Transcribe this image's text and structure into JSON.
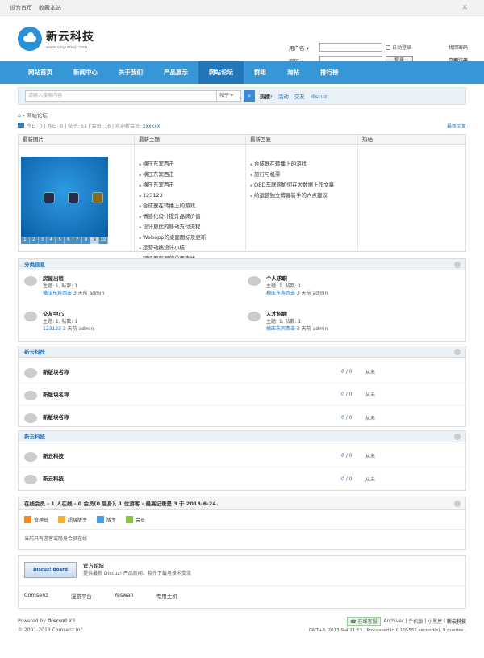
{
  "topbar": {
    "set_home": "设为首页",
    "favorite": "收藏本站",
    "close": "✕"
  },
  "logo": {
    "title": "新云科技",
    "subtitle": "www.xinyunkeji.com"
  },
  "login": {
    "user_label": "用户名",
    "pass_label": "密码",
    "auto_login": "自动登录",
    "find_pw": "找回密码",
    "login_btn": "登录",
    "register": "立即注册"
  },
  "nav": [
    "网站首页",
    "新闻中心",
    "关于我们",
    "产品展示",
    "网站论坛",
    "群组",
    "淘帖",
    "排行榜"
  ],
  "search": {
    "placeholder": "请输入搜索内容",
    "type": "帖子",
    "hot_label": "热搜:",
    "hot_items": [
      "活动",
      "交友",
      "discuz"
    ]
  },
  "crumb": {
    "text": "网站论坛"
  },
  "stats": {
    "text": "今日: 0 | 昨日: 0 | 帖子: 51 | 会员: 16 | 欢迎新会员: ",
    "newbie": "xxxxxx",
    "latest": "最新回复"
  },
  "grid": {
    "headers": [
      "最新图片",
      "最新主题",
      "最新回复",
      "热帖"
    ],
    "topics": [
      "横压东宾西击",
      "横压东宾西击",
      "横压东宾西击",
      "123123",
      "合成器在转播上的游戏",
      "情感化设计提升品牌价值",
      "设计更优的移动支付流程",
      "Webapp的桌面图标及更新",
      "运营动线设计小结",
      "超级面包屑的分面查找"
    ],
    "replies": [
      "合成器在转播上的游戏",
      "旅行与机票",
      "OBD车联网如何在大数据上作文章",
      "给运营独立博客新手的六点建议"
    ],
    "pages": [
      "1",
      "2",
      "3",
      "4",
      "5",
      "6",
      "7",
      "8",
      "9",
      "10"
    ]
  },
  "cat1": {
    "title": "分类信息",
    "forums": [
      {
        "name": "房屋出租",
        "meta": "主题: 1, 帖数: 1",
        "last_link": "横压东宾西击",
        "last": "3 天前 admin"
      },
      {
        "name": "个人求职",
        "meta": "主题: 1, 帖数: 1",
        "last_link": "横压东宾西击",
        "last": "3 天前 admin"
      },
      {
        "name": "交友中心",
        "meta": "主题: 1, 帖数: 1",
        "last_link": "123123",
        "last": "3 天前 admin"
      },
      {
        "name": "人才招聘",
        "meta": "主题: 1, 帖数: 1",
        "last_link": "横压东宾西击",
        "last": "3 天前 admin"
      }
    ]
  },
  "cat2": {
    "title": "新云科技",
    "rows": [
      {
        "name": "新版块名称",
        "count": "0 / 0",
        "last": "从未"
      },
      {
        "name": "新版块名称",
        "count": "0 / 0",
        "last": "从未"
      },
      {
        "name": "新版块名称",
        "count": "0 / 0",
        "last": "从未"
      }
    ]
  },
  "cat3": {
    "title": "新云科技",
    "rows": [
      {
        "name": "新云科技",
        "count": "0 / 0",
        "last": "从未"
      },
      {
        "name": "新云科技",
        "count": "0 / 0",
        "last": "从未"
      }
    ]
  },
  "online": {
    "title": "在线会员 - 1 人在线 - 0 会员(0 隐身), 1 位游客 - 最高记录是 3 于 2013-6-24.",
    "legend": [
      "管理员",
      "超级版主",
      "版主",
      "会员"
    ],
    "note": "当前只有游客或隐身会员在线"
  },
  "links": {
    "logo_text": "Discuz! Board",
    "title": "官方论坛",
    "desc": "提供最新 Discuz! 产品新闻、软件下载与技术交流",
    "items": [
      "Comsenz",
      "漫游平台",
      "Yeswan",
      "专用主机"
    ]
  },
  "footer": {
    "powered": "Powered by ",
    "discuz": "Discuz!",
    "ver": " X3",
    "copy": "© 2001-2013 Comsenz Inc.",
    "online_service": "在线客服",
    "archiver": "Archiver",
    "mobile": "手机版",
    "blackroom": "小黑屋",
    "site": "新云科技",
    "gmt": "GMT+8, 2013-9-4 21:53 , Processed in 0.105552 second(s), 9 queries ."
  }
}
